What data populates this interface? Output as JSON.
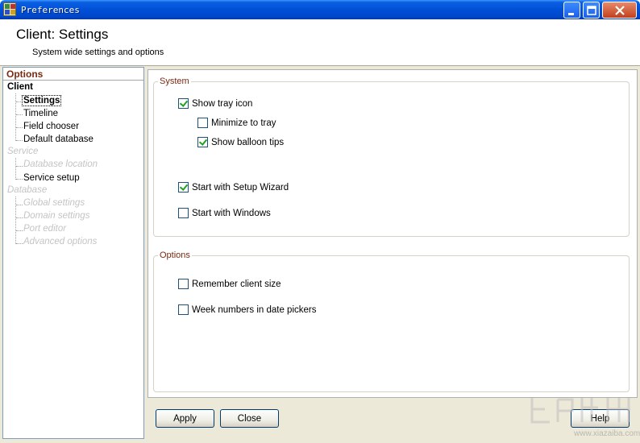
{
  "window": {
    "title": "Preferences"
  },
  "header": {
    "title": "Client: Settings",
    "subtitle": "System wide settings and options"
  },
  "tree": {
    "header": "Options",
    "categories": [
      {
        "label": "Client",
        "enabled": true,
        "items": [
          {
            "label": "Settings",
            "selected": true,
            "enabled": true
          },
          {
            "label": "Timeline",
            "enabled": true
          },
          {
            "label": "Field chooser",
            "enabled": true
          },
          {
            "label": "Default database",
            "enabled": true
          }
        ]
      },
      {
        "label": "Service",
        "enabled": false,
        "items": [
          {
            "label": "Database location",
            "enabled": false
          },
          {
            "label": "Service setup",
            "enabled": true
          }
        ]
      },
      {
        "label": "Database",
        "enabled": false,
        "items": [
          {
            "label": "Global settings",
            "enabled": false
          },
          {
            "label": "Domain settings",
            "enabled": false
          },
          {
            "label": "Port editor",
            "enabled": false
          },
          {
            "label": "Advanced options",
            "enabled": false
          }
        ]
      }
    ]
  },
  "system_group": {
    "legend": "System",
    "show_tray_icon": {
      "label": "Show tray icon",
      "checked": true
    },
    "minimize_to_tray": {
      "label": "Minimize to tray",
      "checked": false
    },
    "show_balloon_tips": {
      "label": "Show balloon tips",
      "checked": true
    },
    "start_with_setup_wizard": {
      "label": "Start with Setup Wizard",
      "checked": true
    },
    "start_with_windows": {
      "label": "Start with Windows",
      "checked": false
    }
  },
  "options_group": {
    "legend": "Options",
    "remember_client_size": {
      "label": "Remember client size",
      "checked": false
    },
    "week_numbers": {
      "label": "Week numbers in date pickers",
      "checked": false
    }
  },
  "buttons": {
    "apply": "Apply",
    "close": "Close",
    "help": "Help"
  },
  "watermark": "www.xiazaiba.com",
  "colors": {
    "titlebar": "#0050d8",
    "accent_text": "#7a2a12",
    "check_mark": "#21a121"
  }
}
